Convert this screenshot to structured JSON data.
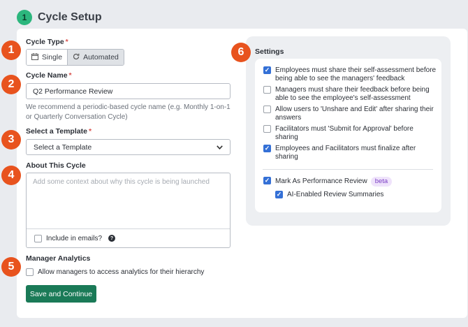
{
  "header": {
    "step_number": "1",
    "title": "Cycle Setup"
  },
  "markers": [
    "1",
    "2",
    "3",
    "4",
    "5",
    "6"
  ],
  "cycle_type": {
    "label": "Cycle Type",
    "required": "*",
    "options": [
      {
        "label": "Single",
        "icon": "calendar-icon",
        "selected": false
      },
      {
        "label": "Automated",
        "icon": "refresh-icon",
        "selected": true
      }
    ]
  },
  "cycle_name": {
    "label": "Cycle Name",
    "required": "*",
    "value": "Q2 Performance Review",
    "hint": "We recommend a periodic-based cycle name (e.g. Monthly 1-on-1 or Quarterly Conversation Cycle)"
  },
  "template": {
    "label": "Select a Template",
    "required": "*",
    "selected": "Select a Template"
  },
  "about": {
    "label": "About This Cycle",
    "placeholder": "Add some context about why this cycle is being launched",
    "include_emails": {
      "label": "Include in emails?",
      "checked": false
    }
  },
  "analytics": {
    "label": "Manager Analytics",
    "option": {
      "label": "Allow managers to access analytics for their hierarchy",
      "checked": false
    }
  },
  "save_button": "Save and Continue",
  "settings": {
    "title": "Settings",
    "options": [
      {
        "line1": "Employees must share their self-assessment before",
        "line2": "being able to see the managers' feedback",
        "checked": true
      },
      {
        "line1": "Managers must share their feedback before being",
        "line2": "able to see the employee's self-assessment",
        "checked": false
      },
      {
        "line1": "Allow users to 'Unshare and Edit' after sharing their",
        "line2": "answers",
        "checked": false
      },
      {
        "line1": "Facilitators must 'Submit for Approval' before",
        "line2": "sharing",
        "checked": false
      },
      {
        "line1": "Employees and Facilitators must finalize after",
        "line2": "sharing",
        "checked": true
      }
    ],
    "performance_review": {
      "label": "Mark As Performance Review",
      "badge": "beta",
      "checked": true
    },
    "ai_summaries": {
      "label": "AI-Enabled Review Summaries",
      "checked": true
    }
  }
}
